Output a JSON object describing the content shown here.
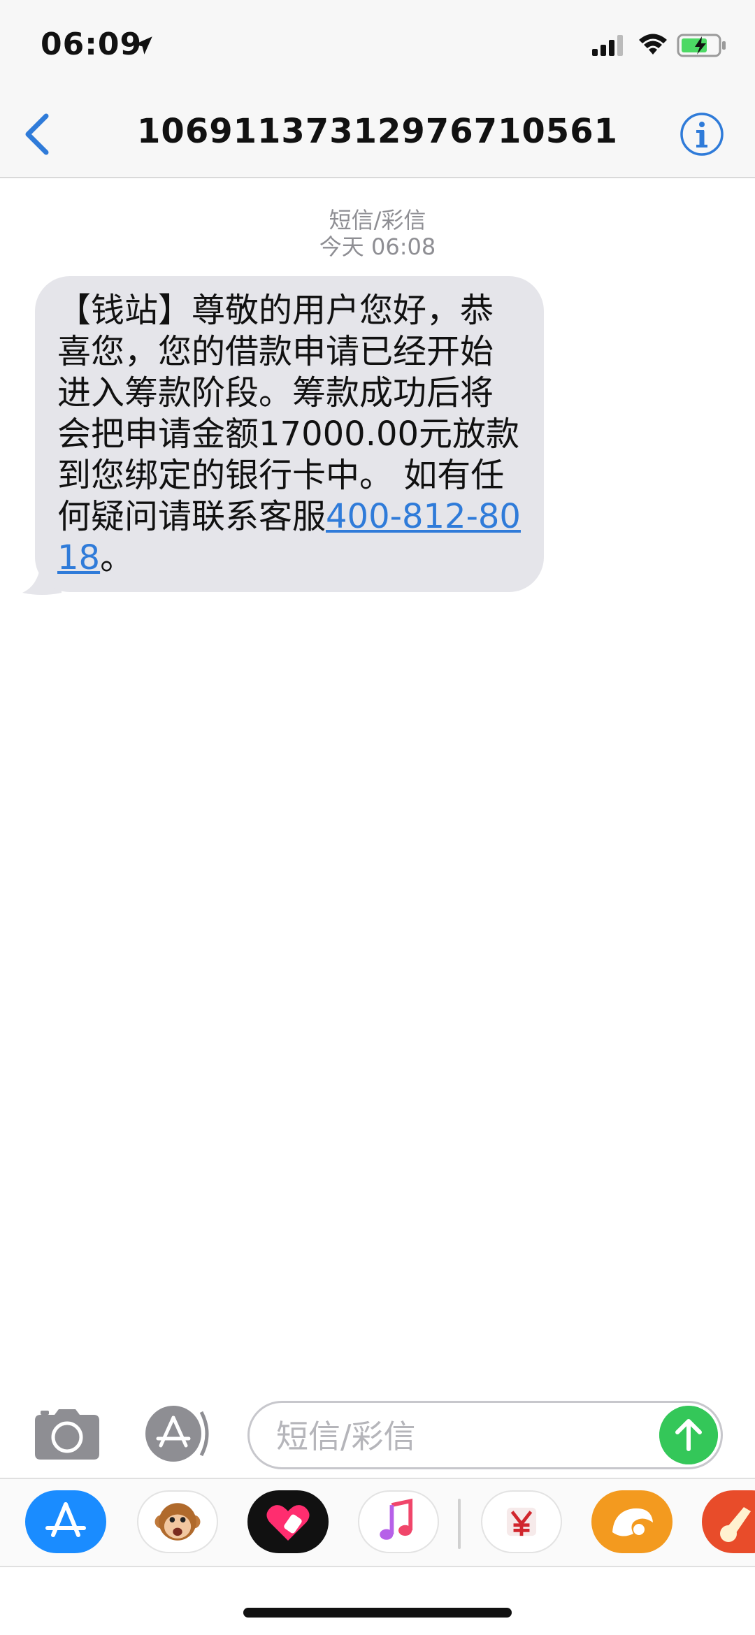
{
  "status_bar": {
    "time": "06:09",
    "battery_color": "#4cd964"
  },
  "nav": {
    "title": "106911373129767105​61"
  },
  "conversation": {
    "message_type": "短信/彩信",
    "timestamp": "今天 06:08",
    "message": {
      "text": "【钱站】尊敬的用户您好，恭喜您，您的借款申请已经开始进入筹款阶段。筹款成功后将会把申请金额17000.00元放款到您绑定的银行卡中。 如有任何疑问请联系客服",
      "phone_link": "400-812-8018",
      "trailing": "。"
    }
  },
  "input": {
    "placeholder": "短信/彩信"
  },
  "app_drawer": {
    "icons": [
      "app-store-icon",
      "animoji-monkey-icon",
      "digital-touch-icon",
      "music-icon",
      "wallet-icon",
      "uc-browser-icon",
      "garageband-icon"
    ]
  },
  "colors": {
    "accent": "#2f7bd9",
    "send": "#34c759",
    "bubble": "#e5e5ea"
  }
}
